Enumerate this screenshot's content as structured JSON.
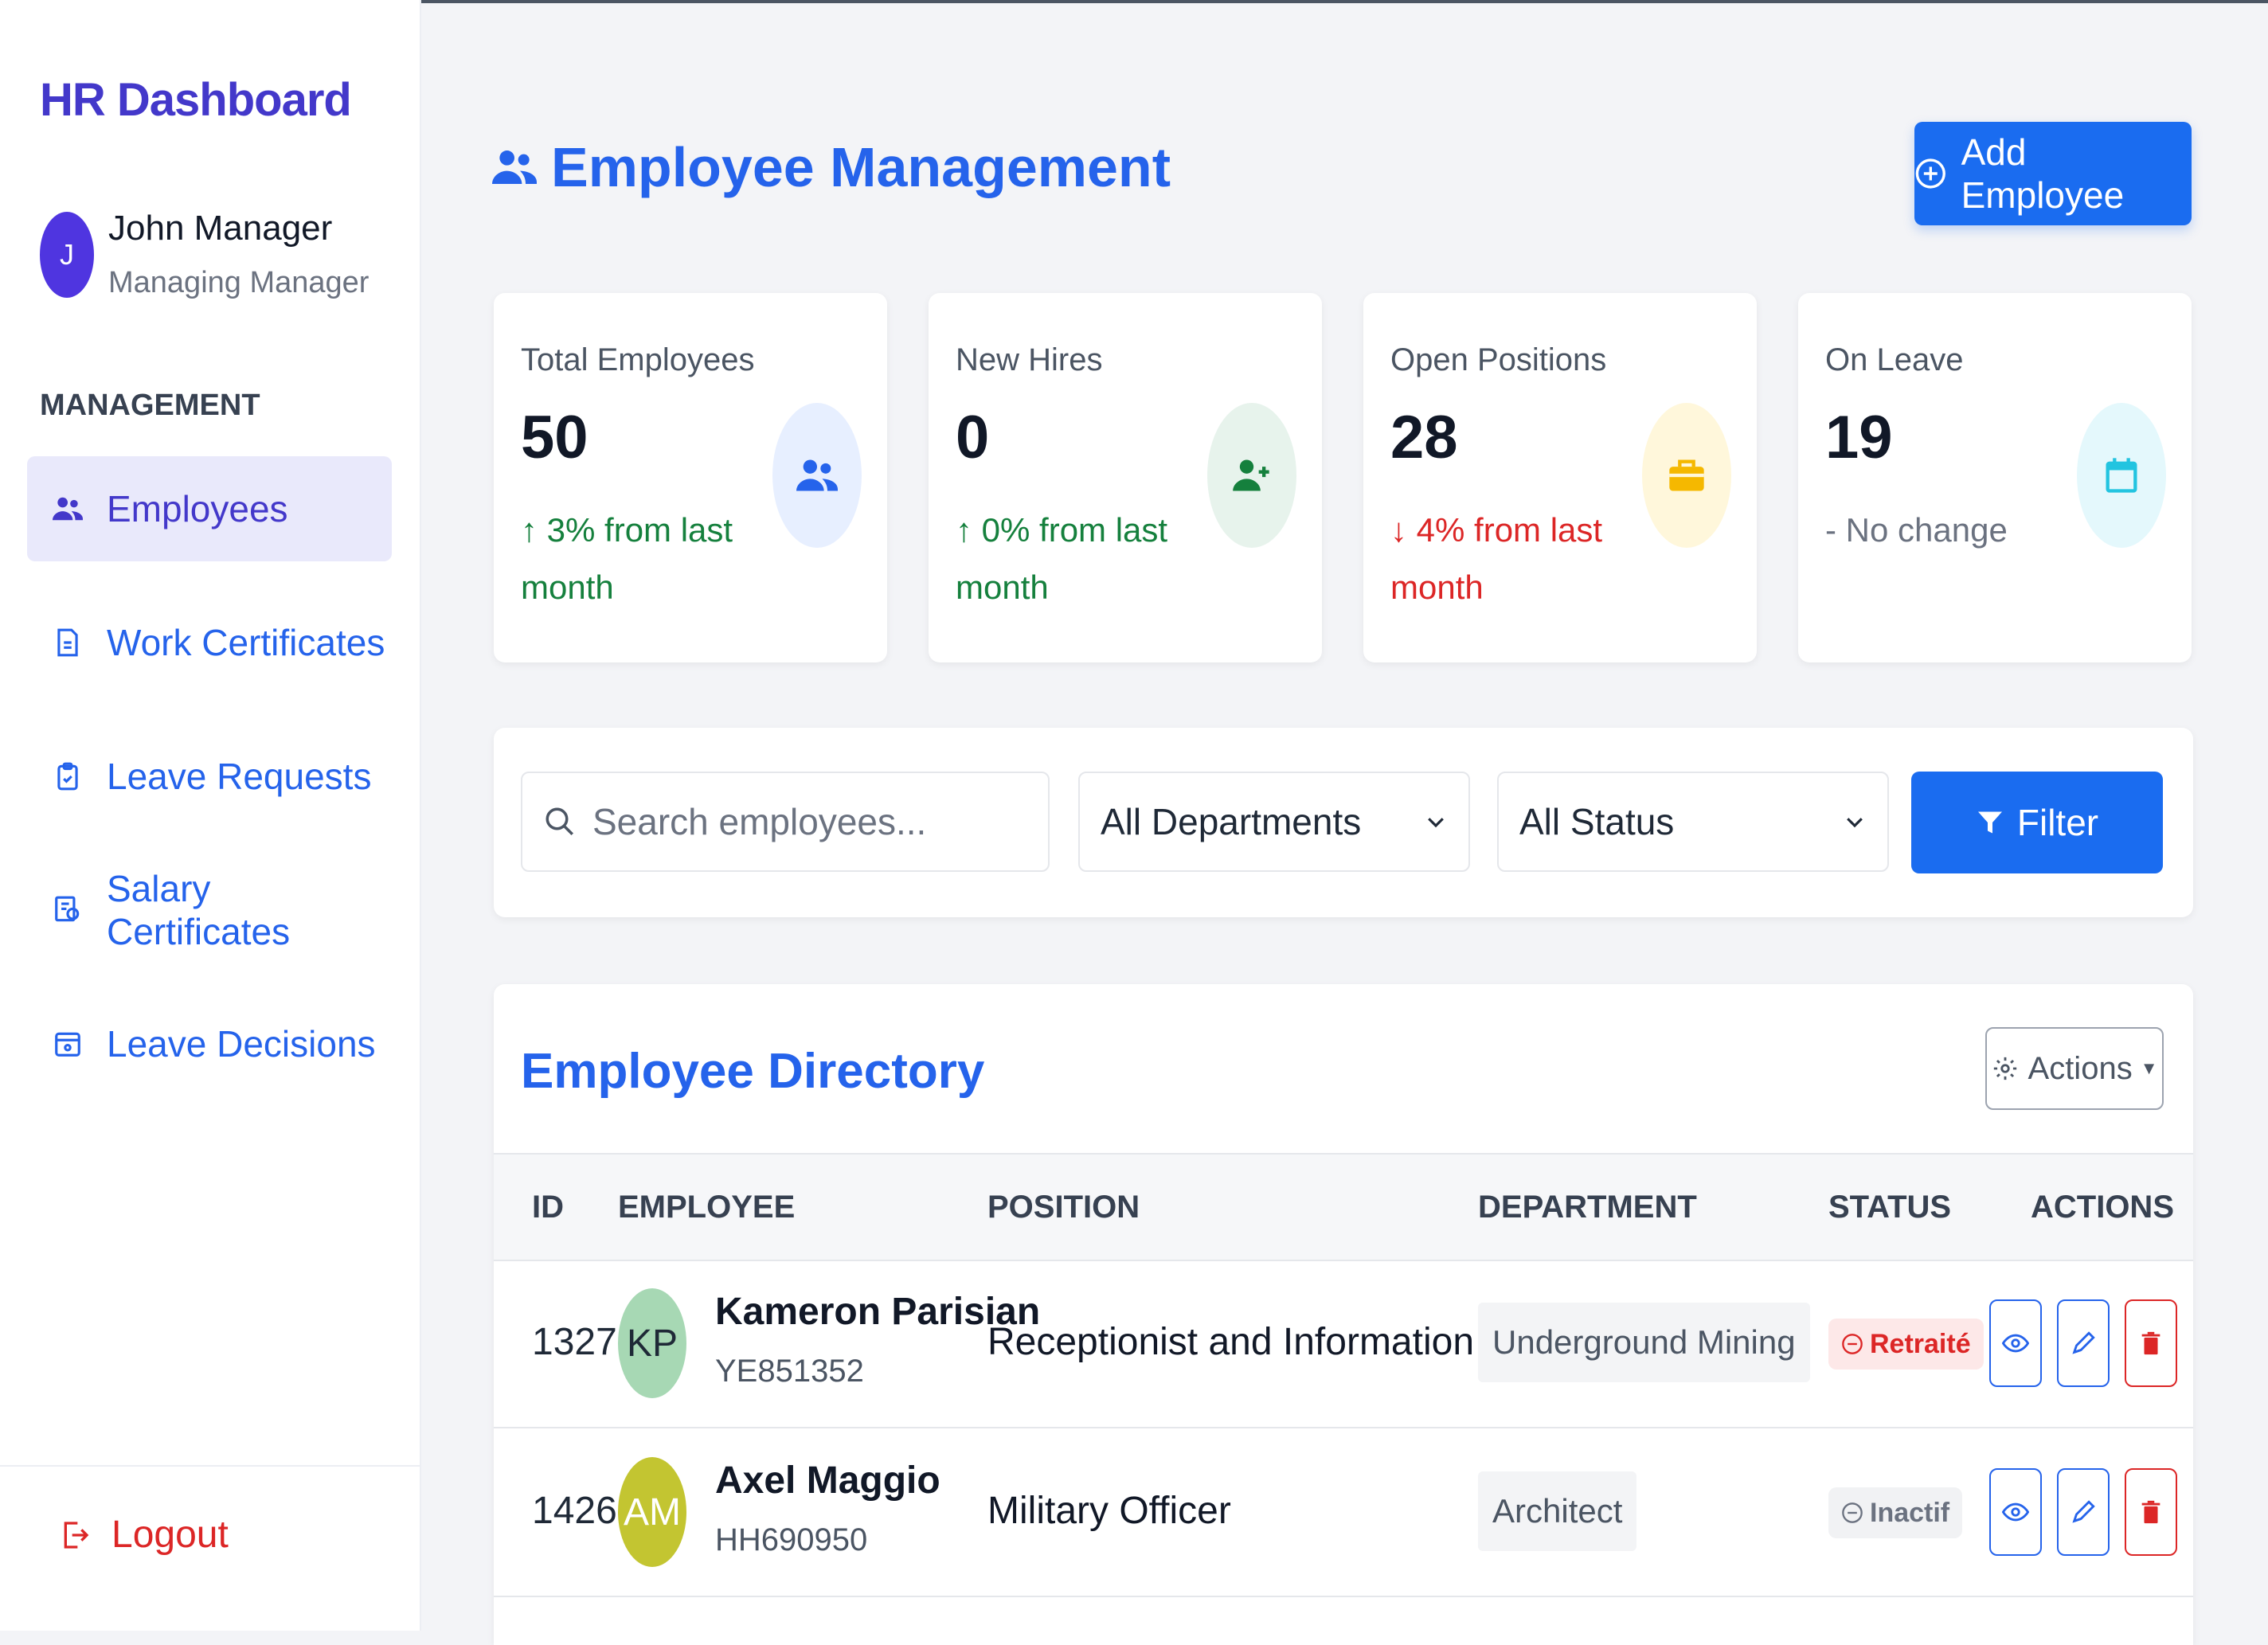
{
  "sidebar": {
    "brand": "HR Dashboard",
    "user": {
      "initial": "J",
      "name": "John Manager",
      "role": "Managing Manager"
    },
    "section_label": "MANAGEMENT",
    "items": [
      {
        "label": "Employees",
        "icon": "users-icon",
        "active": true
      },
      {
        "label": "Work Certificates",
        "icon": "document-icon"
      },
      {
        "label": "Leave Requests",
        "icon": "clipboard-icon"
      },
      {
        "label": "Salary Certificates",
        "icon": "certificate-icon"
      },
      {
        "label": "Leave Decisions",
        "icon": "calendar-icon"
      }
    ],
    "logout_label": "Logout"
  },
  "header": {
    "title": "Employee Management",
    "add_button": "Add Employee"
  },
  "stats": [
    {
      "label": "Total Employees",
      "value": "50",
      "change": "↑ 3% from last month",
      "trend": "up",
      "icon": "users-icon",
      "color": "#2563eb",
      "bg": "#e7efff"
    },
    {
      "label": "New Hires",
      "value": "0",
      "change": "↑ 0% from last month",
      "trend": "up",
      "icon": "user-plus-icon",
      "color": "#15803d",
      "bg": "#e7f3ec"
    },
    {
      "label": "Open Positions",
      "value": "28",
      "change": "↓ 4% from last month",
      "trend": "down",
      "icon": "briefcase-icon",
      "color": "#f5b800",
      "bg": "#fff7db"
    },
    {
      "label": "On Leave",
      "value": "19",
      "change": "- No change",
      "trend": "neutral",
      "icon": "calendar-icon",
      "color": "#22c4e0",
      "bg": "#e4f8fc"
    }
  ],
  "filters": {
    "search_placeholder": "Search employees...",
    "department": "All Departments",
    "status": "All Status",
    "filter_button": "Filter"
  },
  "directory": {
    "title": "Employee Directory",
    "actions_label": "Actions",
    "columns": [
      "ID",
      "EMPLOYEE",
      "POSITION",
      "DEPARTMENT",
      "STATUS",
      "ACTIONS"
    ],
    "rows": [
      {
        "id": "1327",
        "initials": "KP",
        "avatar_color": "#a7d8b4",
        "name": "Kameron Parisian",
        "code": "YE851352",
        "position": "Receptionist and Information Clerk",
        "department": "Underground Mining",
        "status": "Retraité",
        "status_type": "retraite"
      },
      {
        "id": "1426",
        "initials": "AM",
        "avatar_color": "#c3c531",
        "name": "Axel Maggio",
        "code": "HH690950",
        "position": "Military Officer",
        "department": "Architect",
        "status": "Inactif",
        "status_type": "inactif"
      }
    ]
  }
}
